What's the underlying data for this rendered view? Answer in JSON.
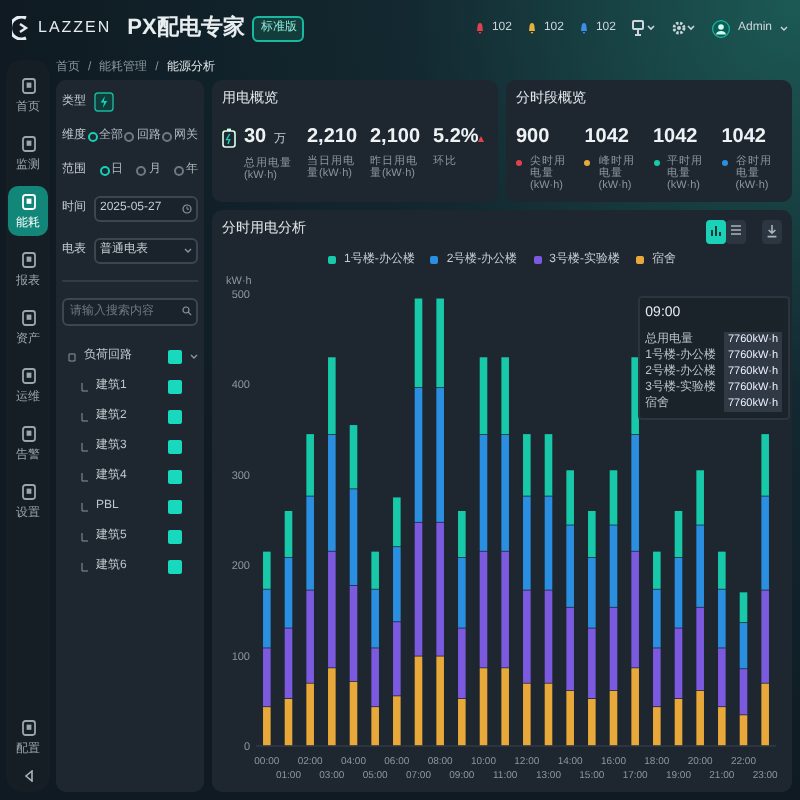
{
  "header": {
    "logo": "LAZZEN",
    "title": "PX配电专家",
    "badge": "标准版",
    "alarms": [
      {
        "count": "102",
        "color": "#e0424b"
      },
      {
        "count": "102",
        "color": "#e8b13a"
      },
      {
        "count": "102",
        "color": "#3b8fe8"
      }
    ],
    "user": "Admin"
  },
  "sidebar": {
    "items": [
      {
        "label": "首页",
        "selected": false
      },
      {
        "label": "监测",
        "selected": false
      },
      {
        "label": "能耗",
        "selected": true
      },
      {
        "label": "报表",
        "selected": false
      },
      {
        "label": "资产",
        "selected": false
      },
      {
        "label": "运维",
        "selected": false
      },
      {
        "label": "告警",
        "selected": false
      },
      {
        "label": "设置",
        "selected": false
      }
    ],
    "bottom_item": {
      "label": "配置"
    }
  },
  "breadcrumb": {
    "separator": "/",
    "items": [
      "首页",
      "能耗管理",
      "能源分析"
    ]
  },
  "filters": {
    "type_label": "类型",
    "dimension": {
      "label": "维度",
      "options": [
        {
          "label": "全部",
          "selected": true
        },
        {
          "label": "回路",
          "selected": false
        },
        {
          "label": "网关",
          "selected": false
        }
      ]
    },
    "range": {
      "label": "范围",
      "options": [
        {
          "label": "日",
          "selected": true
        },
        {
          "label": "月",
          "selected": false
        },
        {
          "label": "年",
          "selected": false
        }
      ]
    },
    "date": {
      "label": "时间",
      "value": "2025-05-27"
    },
    "meter": {
      "label": "电表",
      "value": "普通电表"
    },
    "search": {
      "placeholder": "请输入搜索内容"
    },
    "tree": [
      {
        "label": "负荷回路",
        "checked": true,
        "expanded": true,
        "children": [
          {
            "label": "建筑1",
            "checked": true
          },
          {
            "label": "建筑2",
            "checked": true
          },
          {
            "label": "建筑3",
            "checked": true
          },
          {
            "label": "建筑4",
            "checked": true
          },
          {
            "label": "PBL",
            "checked": true
          },
          {
            "label": "建筑5",
            "checked": true
          },
          {
            "label": "建筑6",
            "checked": true
          }
        ]
      }
    ]
  },
  "usage": {
    "title": "用电概览",
    "stats": [
      {
        "value": "30",
        "unit": "万",
        "label": "总用电量(kW·h)"
      },
      {
        "value": "2,210",
        "label": "当日用电量(kW·h)"
      },
      {
        "value": "2,100",
        "label": "昨日用电量(kW·h)"
      },
      {
        "value": "5.2%",
        "label": "环比",
        "rising": true
      }
    ]
  },
  "periods": {
    "title": "分时段概览",
    "stats": [
      {
        "value": "900",
        "label": "尖时用电量(kW·h)",
        "color": "#e0424b"
      },
      {
        "value": "1042",
        "label": "峰时用电量(kW·h)",
        "color": "#e8a93a"
      },
      {
        "value": "1042",
        "label": "平时用电量(kW·h)",
        "color": "#17c9a9"
      },
      {
        "value": "1042",
        "label": "谷时用电量(kW·h)",
        "color": "#2a8fe0"
      }
    ]
  },
  "chart_panel": {
    "title": "分时用电分析",
    "view_buttons": [
      {
        "kind": "chart",
        "selected": true
      },
      {
        "kind": "table",
        "selected": false
      }
    ],
    "chart_data": {
      "type": "bar",
      "stacked": true,
      "ylabel": "kW·h",
      "ylim": [
        0,
        500
      ],
      "yticks": [
        0,
        100,
        200,
        300,
        400,
        500
      ],
      "categories": [
        "00:00",
        "01:00",
        "02:00",
        "03:00",
        "04:00",
        "05:00",
        "06:00",
        "07:00",
        "08:00",
        "09:00",
        "10:00",
        "11:00",
        "12:00",
        "13:00",
        "14:00",
        "15:00",
        "16:00",
        "17:00",
        "18:00",
        "19:00",
        "20:00",
        "21:00",
        "22:00",
        "23:00"
      ],
      "series": [
        {
          "name": "1号楼-办公楼",
          "color": "#17c9a9",
          "values": [
            42,
            52,
            69,
            86,
            71,
            42,
            55,
            99,
            99,
            52,
            86,
            86,
            69,
            69,
            61,
            52,
            61,
            86,
            42,
            52,
            61,
            42,
            34,
            69
          ]
        },
        {
          "name": "2号楼-办公楼",
          "color": "#2a8fe0",
          "values": [
            65,
            78,
            104,
            129,
            107,
            65,
            83,
            149,
            149,
            78,
            129,
            129,
            104,
            104,
            91,
            78,
            91,
            129,
            65,
            78,
            91,
            65,
            51,
            104
          ]
        },
        {
          "name": "3号楼-实验楼",
          "color": "#7b5ae0",
          "values": [
            65,
            78,
            103,
            129,
            106,
            65,
            82,
            148,
            148,
            78,
            129,
            129,
            103,
            103,
            92,
            78,
            92,
            129,
            65,
            78,
            92,
            65,
            51,
            103
          ]
        },
        {
          "name": "宿舍",
          "color": "#e8a93a",
          "values": [
            43,
            52,
            69,
            86,
            71,
            43,
            55,
            99,
            99,
            52,
            86,
            86,
            69,
            69,
            61,
            52,
            61,
            86,
            43,
            52,
            61,
            43,
            34,
            69
          ]
        }
      ]
    },
    "tooltip": {
      "title": "09:00",
      "rows": [
        {
          "label": "总用电量",
          "value": "7760kW·h"
        },
        {
          "label": "1号楼-办公楼",
          "value": "7760kW·h"
        },
        {
          "label": "2号楼-办公楼",
          "value": "7760kW·h"
        },
        {
          "label": "3号楼-实验楼",
          "value": "7760kW·h"
        },
        {
          "label": "宿舍",
          "value": "7760kW·h"
        }
      ]
    }
  }
}
